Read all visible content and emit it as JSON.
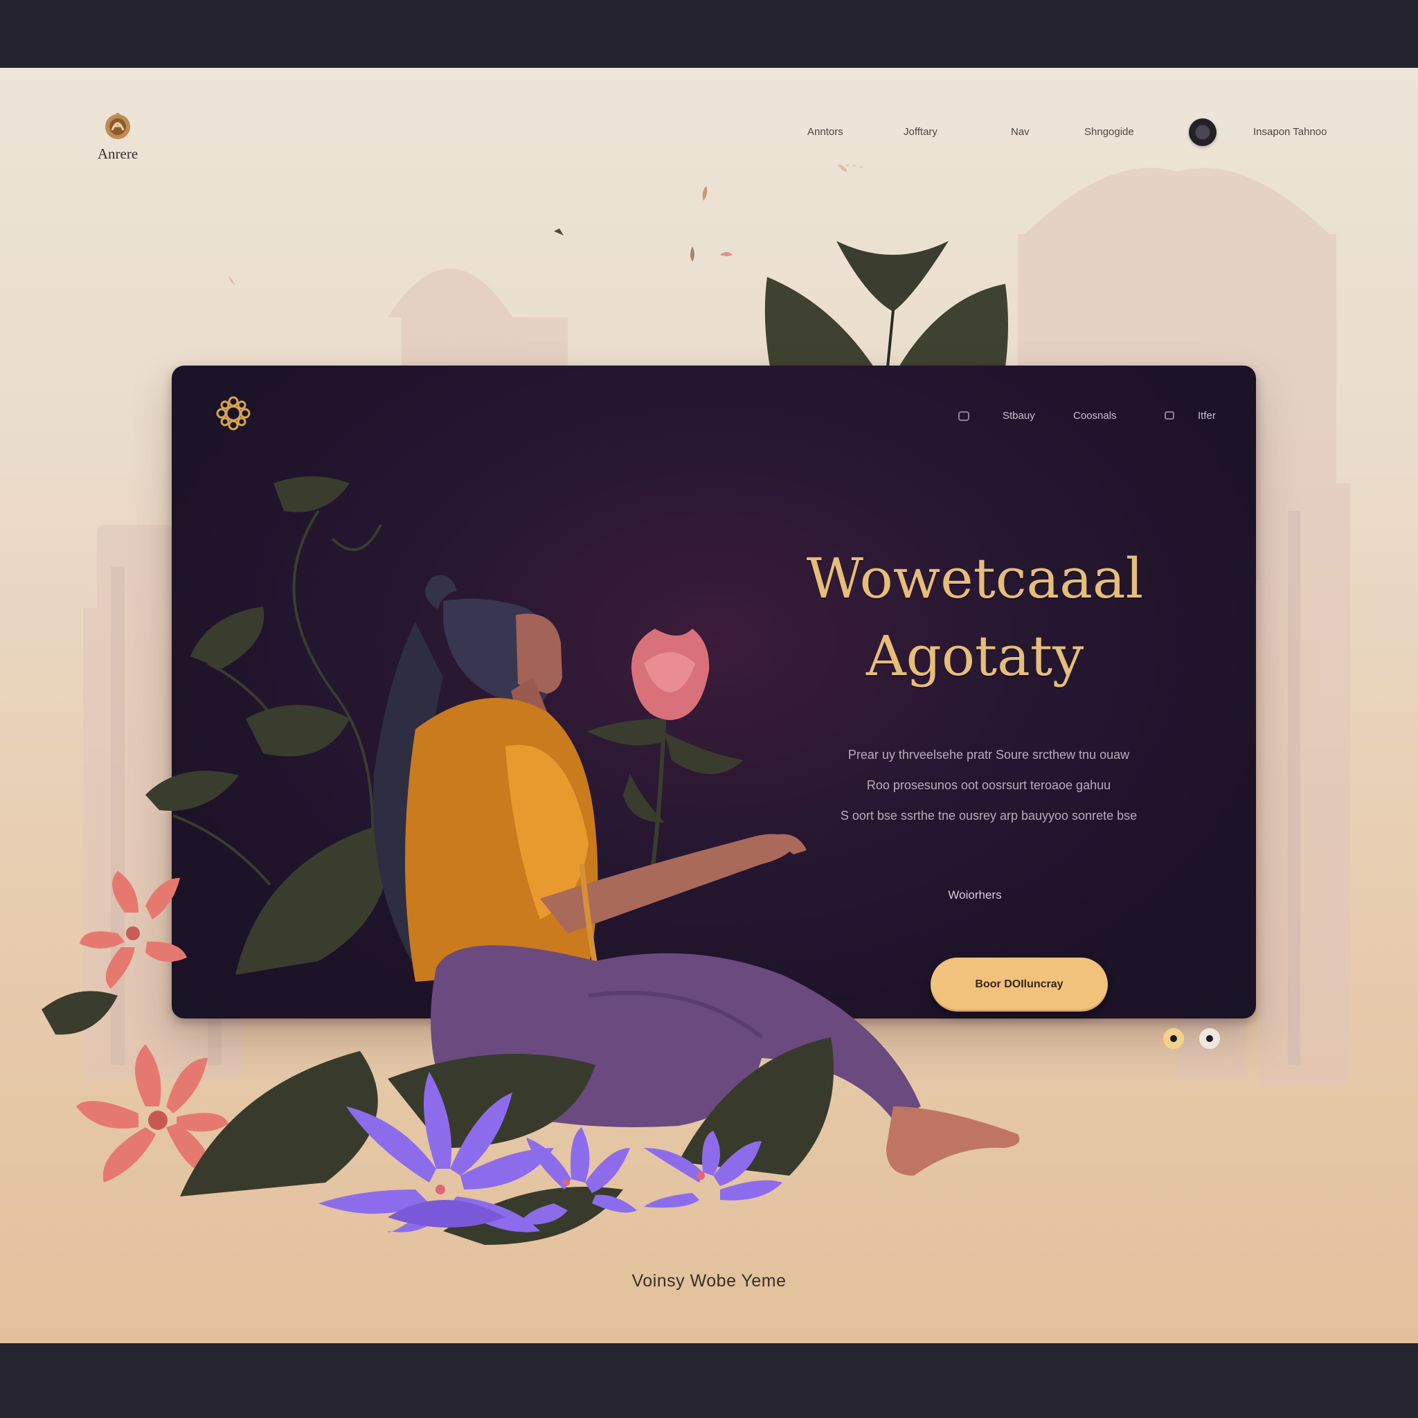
{
  "brand": {
    "name": "Anrere",
    "logo_icon": "ornamental-a-icon"
  },
  "site_nav": {
    "links": [
      "Anntors",
      "Jofftary",
      "Nav",
      "Shngogide"
    ],
    "cta_link": "Insapon Tahnoo",
    "avatar_icon": "avatar-icon"
  },
  "card": {
    "emblem_icon": "mandala-emblem-icon",
    "nav": {
      "items": [
        "Stbauy",
        "Coosnals",
        "Itfer"
      ],
      "icons": [
        "menu-dot-icon",
        "grid-icon"
      ]
    },
    "title": {
      "line1": "Wowetcaaal",
      "line2": "Agotaty"
    },
    "body": [
      "Prear uy thrveelsehe pratr  Soure srcthew tnu ouaw",
      "Roo prosesunos  oot oosrsurt teroaoe gahuu",
      "S oort bse ssrthe tne ousrey arp bauyyoo sonrete bse"
    ],
    "caption": "Woiorhers",
    "cta_label": "Boor DOIluncray",
    "pager": {
      "count": 2,
      "active": 1
    }
  },
  "footer": {
    "text": "Voinsy Wobe Yeme"
  },
  "colors": {
    "accent_gold": "#f0c27c",
    "card_bg": "#1d1328",
    "page_bg_top": "#ece5d8",
    "page_bg_bottom": "#e2c09b",
    "frame": "#25232e",
    "leaf": "#414232",
    "lotus": "#8a6ce8",
    "rose": "#e2787a"
  }
}
